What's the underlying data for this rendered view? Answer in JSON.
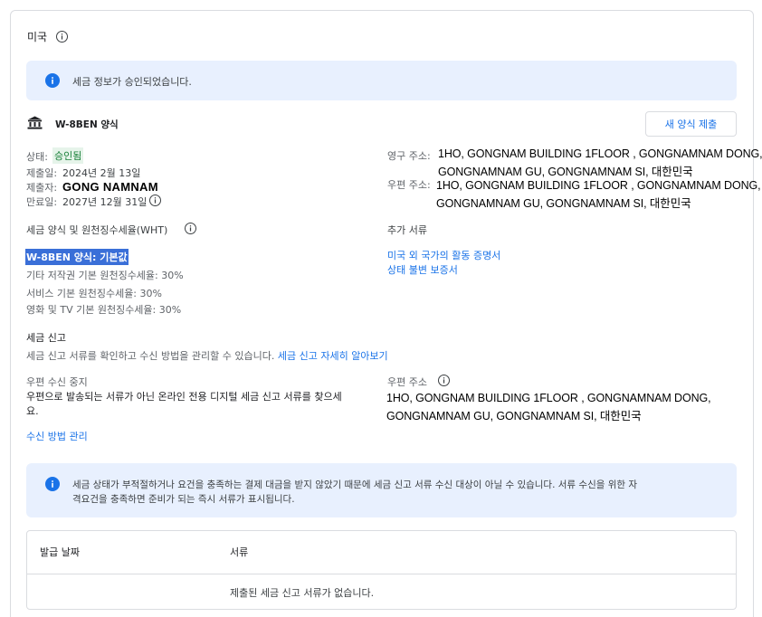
{
  "country": {
    "label": "미국"
  },
  "approved_banner": {
    "message": "세금 정보가 승인되었습니다."
  },
  "form": {
    "title": "W-8BEN 양식",
    "new_form_button": "새 양식 제출",
    "status_label": "상태:",
    "status_value": "승인됨",
    "submitted_label": "제출일:",
    "submitted_value": "2024년 2월 13일",
    "submitter_label": "제출자:",
    "submitter_value": "GONG NAMNAM",
    "expiry_label": "만료일:",
    "expiry_value": "2027년 12월 31일",
    "permanent_address_label": "영구 주소:",
    "permanent_address_line1": "1HO, GONGNAM BUILDING 1FLOOR , GONGNAMNAM DONG,",
    "permanent_address_line2": "GONGNAMNAM GU, GONGNAMNAM SI, 대한민국",
    "mailing_address_label": "우편 주소:",
    "mailing_address_line1": "1HO, GONGNAM BUILDING 1FLOOR , GONGNAMNAM DONG,",
    "mailing_address_line2": "GONGNAMNAM GU, GONGNAMNAM SI, 대한민국"
  },
  "withholding": {
    "heading": "세금 양식 및 원천징수세율(WHT)",
    "form_default": "W-8BEN 양식: 기본값",
    "rates": [
      "기타 저작권 기본 원천징수세율: 30%",
      "서비스 기본 원천징수세율: 30%",
      "영화 및 TV 기본 원천징수세율: 30%"
    ]
  },
  "additional_docs": {
    "heading": "추가 서류",
    "links": [
      "미국 외 국가의 활동 증명서",
      "상태 불변 보증서"
    ]
  },
  "tax_filing": {
    "heading": "세금 신고",
    "description": "세금 신고 서류를 확인하고 수신 방법을 관리할 수 있습니다.",
    "learn_more": "세금 신고 자세히 알아보기"
  },
  "mail_stop": {
    "heading": "우편 수신 중지",
    "description_line1": "우편으로 발송되는 서류가 아닌 온라인 전용 디지털 세금 신고 서류를 찾으세",
    "description_line2": "요.",
    "manage_link": "수신 방법 관리"
  },
  "mail_address": {
    "heading": "우편 주소",
    "line1": "1HO, GONGNAM BUILDING 1FLOOR , GONGNAMNAM DONG,",
    "line2": "GONGNAMNAM GU, GONGNAMNAM SI, 대한민국"
  },
  "eligibility_banner": {
    "line1": "세금 상태가 부적절하거나 요건을 충족하는 결제 대금을 받지 않았기 때문에 세금 신고 서류 수신 대상이 아닐 수 있습니다. 서류 수신을 위한 자",
    "line2": "격요건을 충족하면 준비가 되는 즉시 서류가 표시됩니다."
  },
  "documents_table": {
    "col_date": "발급 날짜",
    "col_document": "서류",
    "empty_message": "제출된 세금 신고 서류가 없습니다."
  },
  "colors": {
    "accent": "#1a73e8",
    "banner_bg": "#e8f0fe",
    "status_green": "#188038",
    "highlight": "#3a6fd8"
  },
  "icons": [
    "info-icon",
    "bank-icon"
  ]
}
